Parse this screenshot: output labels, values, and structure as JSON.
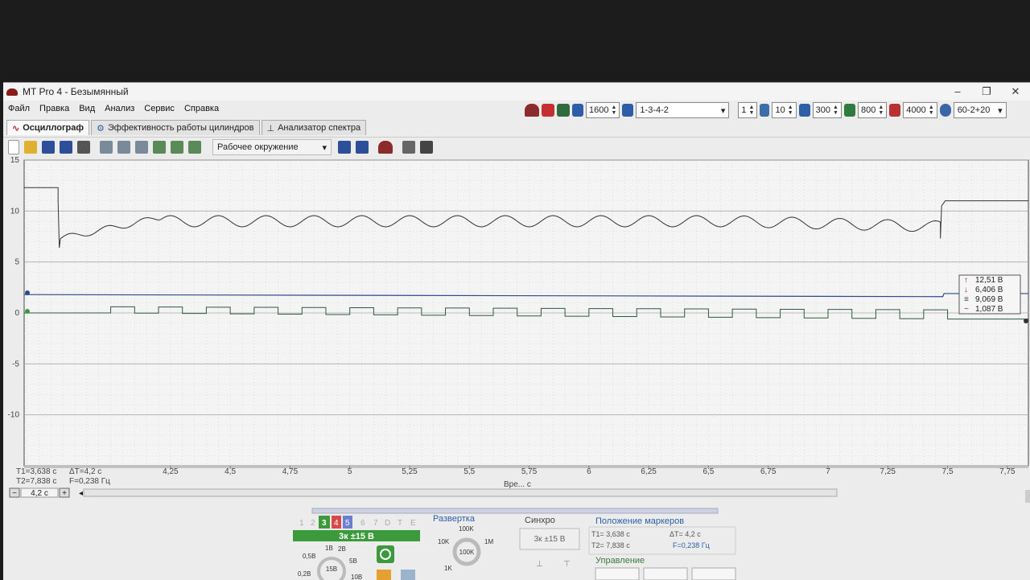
{
  "app": {
    "title": "MT Pro 4 - Безымянный"
  },
  "menu": [
    "Файл",
    "Правка",
    "Вид",
    "Анализ",
    "Сервис",
    "Справка"
  ],
  "top_controls": {
    "rpm": "1600",
    "firing_order": "1-3-4-2",
    "cylinder": "1",
    "spark_count": "10",
    "threshold_1": "300",
    "threshold_2": "800",
    "threshold_3": "4000",
    "wheel_type": "60-2+20"
  },
  "tabs": [
    "Осциллограф",
    "Эффективность работы цилиндров",
    "Анализатор спектра"
  ],
  "toolbar": {
    "environment": "Рабочее окружение"
  },
  "y_ticks": [
    "15",
    "10",
    "5",
    "0",
    "-5",
    "-10"
  ],
  "x_ticks": [
    "4,25",
    "4,5",
    "4,75",
    "5",
    "5,25",
    "5,5",
    "5,75",
    "6",
    "6,25",
    "6,5",
    "6,75",
    "7",
    "7,25",
    "7,5",
    "7,75"
  ],
  "x_unit": "Вре... с",
  "markers": {
    "t1": "T1=3,638 с",
    "dt": "ΔT=4,2 с",
    "t2": "T2=7,838 с",
    "f": "F=0,238 Гц"
  },
  "zoom_value": "4,2 с",
  "measurements": [
    {
      "icon": "↑",
      "value": "12,51 В"
    },
    {
      "icon": "↓",
      "value": "6,406 В"
    },
    {
      "icon": "≡",
      "value": "9,069 В"
    },
    {
      "icon": "~",
      "value": "1,087 В"
    }
  ],
  "channels": {
    "numbers": [
      "1",
      "2",
      "3",
      "4",
      "5",
      "6",
      "7",
      "D",
      "T",
      "E"
    ],
    "selected_label": "3к ±15 В"
  },
  "sweep": {
    "title": "Развертка",
    "labels": [
      "100K",
      "10K",
      "1M",
      "1K"
    ],
    "value": "100K"
  },
  "sync": {
    "title": "Синхро",
    "value": "3к ±15 В"
  },
  "marker_position": {
    "title": "Положение маркеров",
    "t1": "T1= 3,638 с",
    "t2": "T2= 7,838 с",
    "dt": "ΔT= 4,2 с",
    "f": "F=0,238 Гц"
  },
  "control": {
    "title": "Управление"
  },
  "volt_knob": {
    "labels": [
      "1В",
      "2В",
      "0,5В",
      "5В",
      "0,2В",
      "10В"
    ],
    "value": "15В"
  },
  "colors": {
    "trace": "#333333",
    "trace_blue": "#2b4a8a",
    "trace_green": "#2e5a3c",
    "accent_green": "#3c9a3c",
    "title_blue": "#2a5fa8",
    "grid": "#bbbbbb"
  }
}
